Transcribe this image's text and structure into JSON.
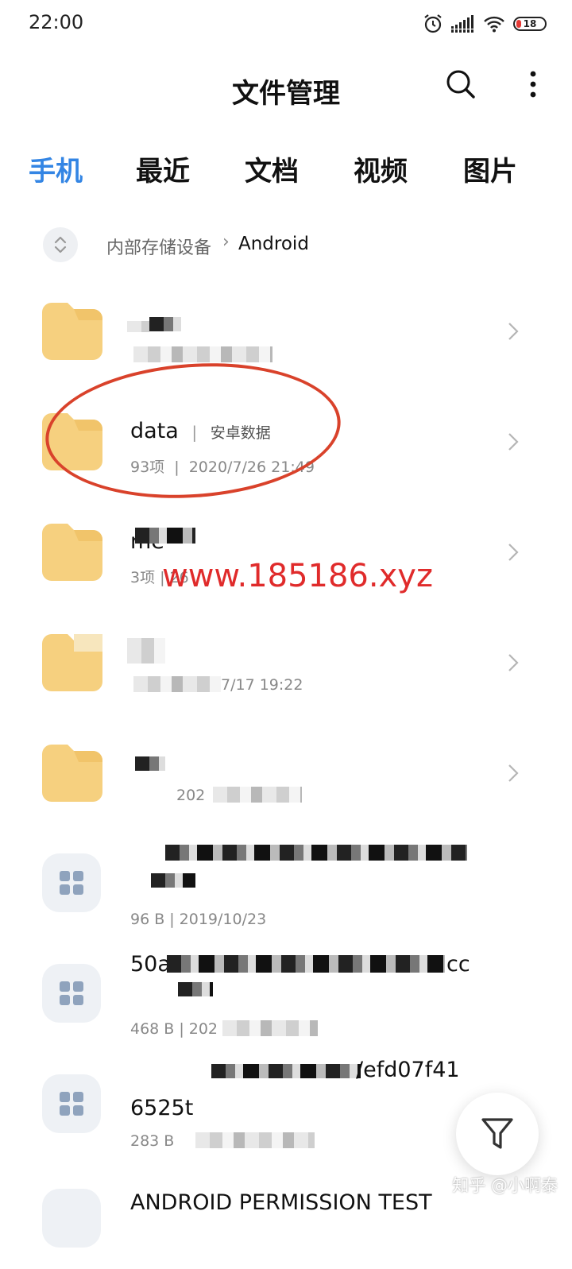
{
  "status_bar": {
    "time": "22:00",
    "battery_level": "18",
    "icons": [
      "alarm-icon",
      "signal-icon",
      "wifi-icon",
      "battery-icon"
    ]
  },
  "app": {
    "title": "文件管理",
    "actions": [
      "search-icon",
      "more-vertical-icon"
    ]
  },
  "tabs": [
    {
      "label": "手机",
      "active": true
    },
    {
      "label": "最近",
      "active": false
    },
    {
      "label": "文档",
      "active": false
    },
    {
      "label": "视频",
      "active": false
    },
    {
      "label": "图片",
      "active": false
    }
  ],
  "breadcrumb": {
    "root": "内部存储设备",
    "separator": "›",
    "current": "Android"
  },
  "items": [
    {
      "type": "folder",
      "name": "",
      "meta": ""
    },
    {
      "type": "folder",
      "name": "data",
      "label": "安卓数据",
      "count": "93项",
      "date": "2020/7/26 21:49"
    },
    {
      "type": "folder",
      "name": "me",
      "count": "3项",
      "date": "26"
    },
    {
      "type": "folder",
      "name": "",
      "date": "7/17 19:22"
    },
    {
      "type": "folder",
      "name": "",
      "date": "202"
    },
    {
      "type": "file",
      "name": "",
      "size": "96 B",
      "date": "2019/10/23"
    },
    {
      "type": "file",
      "name": "50a",
      "name_tail": "cc",
      "size": "468 B",
      "date": "202"
    },
    {
      "type": "file",
      "name": "/efd07f41",
      "name2": "6525t",
      "size": "283 B",
      "date": ""
    },
    {
      "type": "file",
      "name": "ANDROID PERMISSION TEST"
    }
  ],
  "overlays": {
    "watermark_url": "www.185186.xyz",
    "watermark_credit": "知乎 @小啊泰"
  },
  "fab": {
    "icon": "filter-icon"
  },
  "colors": {
    "accent": "#3385e4",
    "folder": "#f6d07f",
    "annotation": "#d9422b",
    "watermark": "#e02b2b"
  }
}
